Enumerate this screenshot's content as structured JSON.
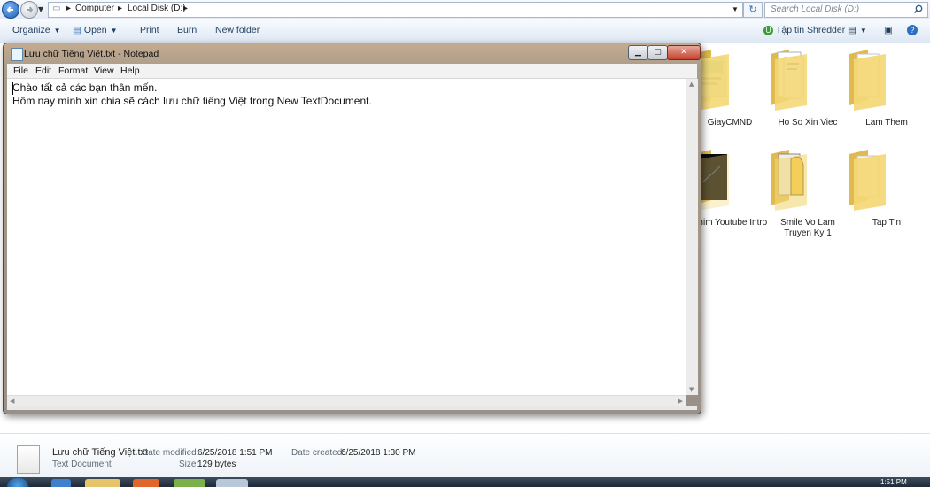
{
  "explorer": {
    "address": {
      "seg1": "Computer",
      "seg2": "Local Disk (D:)"
    },
    "search_placeholder": "Search Local Disk (D:)",
    "toolbar": {
      "organize": "Organize",
      "open": "Open",
      "print": "Print",
      "burn": "Burn",
      "new_folder": "New folder",
      "shredder": "Tập tin Shredder"
    },
    "folders": [
      {
        "label": "GiayCMND"
      },
      {
        "label": "Ho So Xin Viec"
      },
      {
        "label": "Lam Them"
      },
      {
        "label": "Phim Youtube Intro"
      },
      {
        "label": "Smile Vo Lam Truyen Ky 1"
      },
      {
        "label": "Tap Tin"
      }
    ],
    "details": {
      "file_name": "Lưu chữ Tiếng Việt.txt",
      "file_type": "Text Document",
      "date_modified_label": "Date modified:",
      "date_modified": "6/25/2018 1:51 PM",
      "date_created_label": "Date created:",
      "date_created": "6/25/2018 1:30 PM",
      "size_label": "Size:",
      "size": "129 bytes"
    }
  },
  "notepad": {
    "title": "Lưu chữ Tiếng Việt.txt - Notepad",
    "menu": [
      "File",
      "Edit",
      "Format",
      "View",
      "Help"
    ],
    "lines": [
      "Chào tất cả các bạn thân mến.",
      "Hôm nay mình xin chia sẽ cách lưu chữ tiếng Việt trong New TextDocument."
    ]
  },
  "taskbar": {
    "clock": "1:51 PM"
  },
  "colors": {
    "folder": "#f2d36b",
    "accent": "#1f5fb0",
    "close": "#c3402c"
  }
}
